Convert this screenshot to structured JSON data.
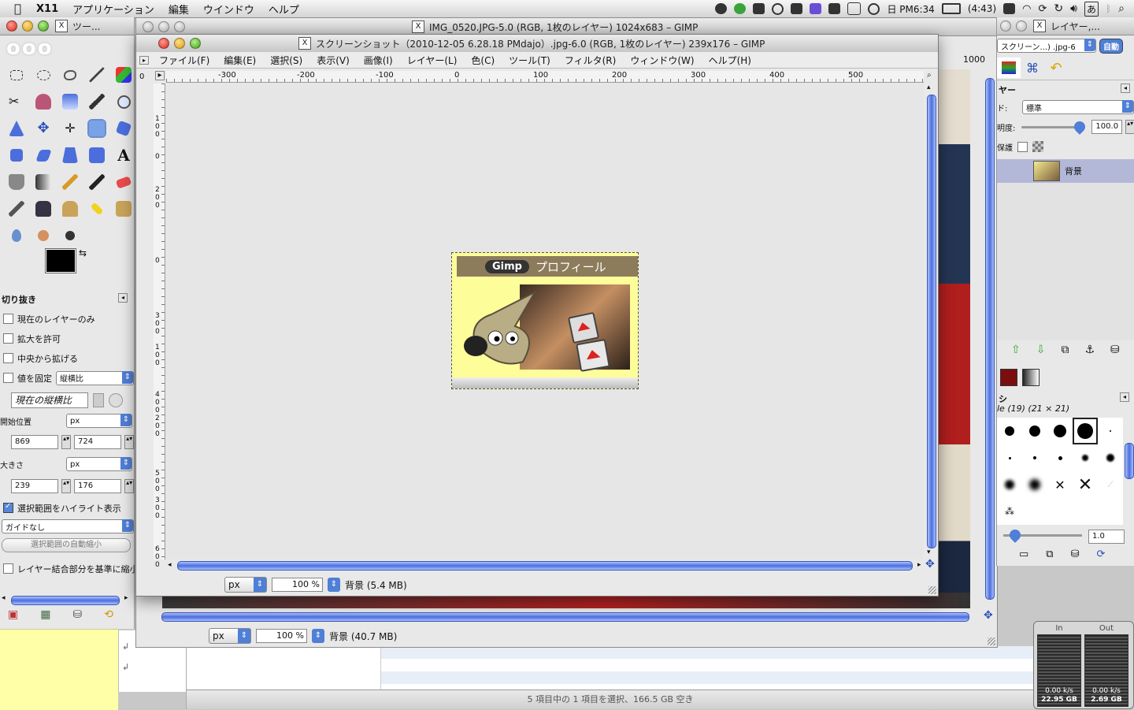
{
  "menubar": {
    "app": "X11",
    "items": [
      "アプリケーション",
      "編集",
      "ウインドウ",
      "ヘルプ"
    ],
    "clock": "日 PM6:34",
    "battery": "(4:43)",
    "lang": "あ"
  },
  "toolbox": {
    "title": "ツー...",
    "options_title": "切り抜き",
    "current_layer_only": "現在のレイヤーのみ",
    "allow_grow": "拡大を許可",
    "expand_center": "中央から拡げる",
    "fixed_label": "値を固定",
    "fixed_value": "縦横比",
    "aspect_field": "現在の縦横比",
    "position_label": "開始位置",
    "position_unit": "px",
    "pos_x": "869",
    "pos_y": "724",
    "size_label": "大きさ",
    "size_unit": "px",
    "size_w": "239",
    "size_h": "176",
    "highlight": "選択範囲をハイライト表示",
    "guides": "ガイドなし",
    "auto_shrink": "選択範囲の自動縮小",
    "merged_shrink": "レイヤー結合部分を基準に縮小"
  },
  "backwin": {
    "title": "IMG_0520.JPG-5.0 (RGB, 1枚のレイヤー) 1024x683 – GIMP",
    "ruler_right": "1000",
    "menu_stub": "フ",
    "unit": "px",
    "zoom": "100 %",
    "status": "背景 (40.7 MB)"
  },
  "frontwin": {
    "title": "スクリーンショット（2010-12-05 6.28.18 PMdajo）.jpg-6.0 (RGB, 1枚のレイヤー) 239x176 – GIMP",
    "menu": [
      "ファイル(F)",
      "編集(E)",
      "選択(S)",
      "表示(V)",
      "画像(I)",
      "レイヤー(L)",
      "色(C)",
      "ツール(T)",
      "フィルタ(R)",
      "ウィンドウ(W)",
      "ヘルプ(H)"
    ],
    "ruler_h": [
      "-300",
      "-200",
      "-100",
      "0",
      "100",
      "200",
      "300",
      "400",
      "500"
    ],
    "ruler_v": [
      "0",
      "100",
      "1000",
      "200",
      "0",
      "300",
      "100",
      "400",
      "200",
      "500",
      "300",
      "600"
    ],
    "ruler_origin": "0",
    "unit": "px",
    "zoom": "100 %",
    "status": "背景 (5.4 MB)"
  },
  "image": {
    "tag": "Gimp",
    "heading": "プロフィール"
  },
  "dock": {
    "title": "レイヤー,...",
    "image_select": "スクリーン...) .jpg-6",
    "auto": "自動",
    "layers_tab": "ヤー",
    "mode_label": "ド:",
    "mode_value": "標準",
    "opacity_label": "明度:",
    "opacity": 100.0,
    "opacity_text": "100.0",
    "lock_label": "保護",
    "layer_name": "背景",
    "brushes_tab": "シ",
    "brush_name": "le (19) (21 × 21)",
    "spacing": "1.0"
  },
  "finder": {
    "status": "5 項目中の 1 項目を選択、166.5 GB 空き"
  },
  "netmon": {
    "in_label": "In",
    "out_label": "Out",
    "in_rate": "0.00 k/s",
    "in_total": "22.95 GB",
    "out_rate": "0.00 k/s",
    "out_total": "2.69 GB"
  },
  "colors": {
    "accent": "#4f7fd6",
    "layer_selected": "#b4b8d8",
    "note": "#ffffa8"
  }
}
